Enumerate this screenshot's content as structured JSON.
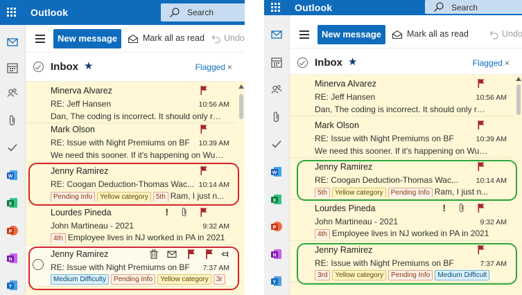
{
  "left_panel": {
    "app_name": "Outlook",
    "search": {
      "placeholder": "Search"
    },
    "rail_icons": [
      "mail-icon",
      "calendar-icon",
      "people-icon",
      "attachment-icon",
      "todo-icon",
      "word-icon",
      "excel-icon",
      "powerpoint-icon",
      "onenote-icon",
      "yammer-icon"
    ],
    "toolbar": {
      "new_message": "New message",
      "mark_all_read": "Mark all as read",
      "undo": "Undo"
    },
    "inbox": {
      "title": "Inbox",
      "filter": "Flagged",
      "filter_close": "×"
    },
    "messages": [
      {
        "sender": "Minerva Alvarez",
        "subject": "RE: Jeff Hansen",
        "time": "10:56 AM",
        "preview": "Dan, The coding is incorrect. It should only read...",
        "flagged": true
      },
      {
        "sender": "Mark Olson",
        "subject": "RE: Issue with Night Premiums on BF",
        "time": "10:39 AM",
        "preview": "We need this sooner. If it's happening on Wu T...",
        "flagged": true
      },
      {
        "sender": "Jenny Ramirez",
        "subject": "RE: Coogan Deduction-Thomas Wac...",
        "time": "10:14 AM",
        "categories": [
          "Pending Info",
          "Yellow category",
          "5th"
        ],
        "preview": "Ram, I just n...",
        "flagged": true
      },
      {
        "sender": "Lourdes Pineda",
        "subject": "John Martineau - 2021",
        "time": "9:32 AM",
        "categories": [
          "4th"
        ],
        "preview": "Employee lives in NJ worked in PA in 2021...",
        "flagged": true,
        "important": "!",
        "attachment": true
      },
      {
        "sender": "Jenny Ramirez",
        "subject": "RE: Issue with Night Premiums on BF",
        "time": "7:37 AM",
        "categories": [
          "Medium Difficulty",
          "Pending Info",
          "Yellow category",
          "3r"
        ],
        "flagged": true
      }
    ]
  },
  "right_panel": {
    "app_name": "Outlook",
    "search": {
      "placeholder": "Search"
    },
    "rail_icons": [
      "mail-icon",
      "calendar-icon",
      "people-icon",
      "attachment-icon",
      "todo-icon",
      "word-icon",
      "excel-icon",
      "powerpoint-icon",
      "onenote-icon",
      "yammer-icon"
    ],
    "toolbar": {
      "new_message": "New message",
      "mark_all_read": "Mark all as read",
      "undo": "Undo"
    },
    "inbox": {
      "title": "Inbox",
      "filter": "Flagged",
      "filter_close": "×"
    },
    "messages": [
      {
        "sender": "Minerva Alvarez",
        "subject": "RE: Jeff Hansen",
        "time": "10:56 AM",
        "preview": "Dan, The coding is incorrect. It should only rea...",
        "flagged": true
      },
      {
        "sender": "Mark Olson",
        "subject": "RE: Issue with Night Premiums on BF",
        "time": "10:39 AM",
        "preview": "We need this sooner. If it's happening on Wu T...",
        "flagged": true
      },
      {
        "sender": "Jenny Ramirez",
        "subject": "RE: Coogan Deduction-Thomas Wac...",
        "time": "10:14 AM",
        "categories": [
          "5th",
          "Yellow category",
          "Pending Info"
        ],
        "preview": "Ram, I just n...",
        "flagged": true
      },
      {
        "sender": "Lourdes Pineda",
        "subject": "John Martineau - 2021",
        "time": "9:32 AM",
        "categories": [
          "4th"
        ],
        "preview": "Employee lives in NJ worked in PA in 2021...",
        "flagged": true,
        "important": "!",
        "attachment": true
      },
      {
        "sender": "Jenny Ramirez",
        "subject": "RE: Issue with Night Premiums on BF",
        "time": "7:37 AM",
        "categories": [
          "3rd",
          "Yellow category",
          "Pending Info",
          "Medium Difficult"
        ],
        "flagged": true
      }
    ]
  },
  "colors": {
    "brand_blue": "#0f6cbd",
    "flagged_row_bg": "#fff7d6",
    "flag_red": "#a4262c",
    "highlight_red": "#d4242b",
    "highlight_green": "#2ba83b"
  }
}
